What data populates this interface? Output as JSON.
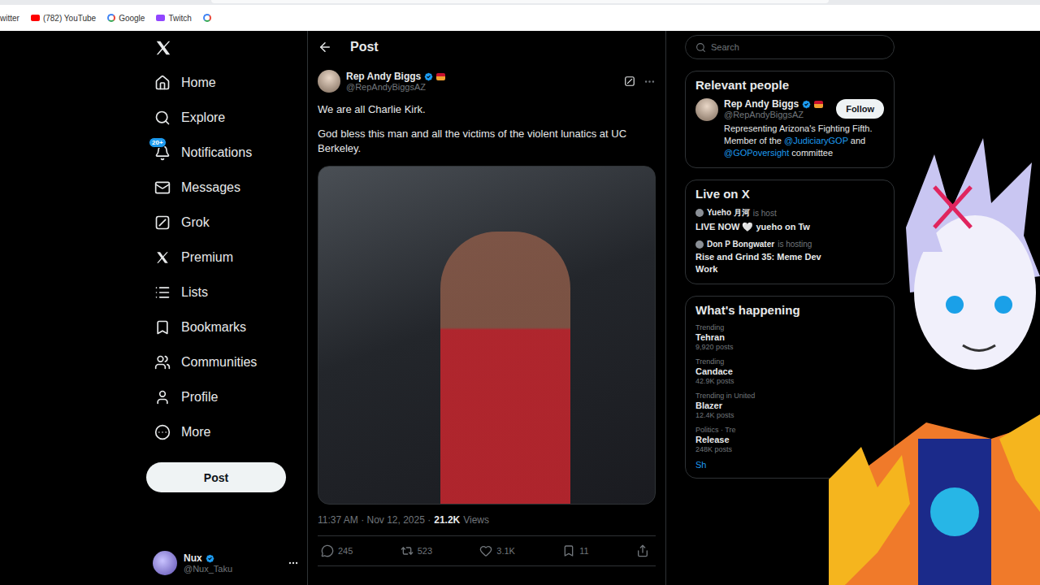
{
  "browser": {
    "bookmarks": [
      {
        "kind": "plain",
        "label": "witter"
      },
      {
        "kind": "youtube",
        "label": "(782) YouTube"
      },
      {
        "kind": "google",
        "label": "Google"
      },
      {
        "kind": "twitch",
        "label": "Twitch"
      },
      {
        "kind": "google",
        "label": ""
      }
    ]
  },
  "nav": {
    "items": [
      {
        "icon": "home",
        "label": "Home",
        "selected": false
      },
      {
        "icon": "explore",
        "label": "Explore",
        "selected": false
      },
      {
        "icon": "notifications",
        "label": "Notifications",
        "selected": false,
        "badge": "20+"
      },
      {
        "icon": "messages",
        "label": "Messages",
        "selected": false
      },
      {
        "icon": "grok",
        "label": "Grok",
        "selected": false
      },
      {
        "icon": "premium",
        "label": "Premium",
        "selected": false
      },
      {
        "icon": "lists",
        "label": "Lists",
        "selected": false
      },
      {
        "icon": "bookmarks",
        "label": "Bookmarks",
        "selected": false
      },
      {
        "icon": "communities",
        "label": "Communities",
        "selected": false
      },
      {
        "icon": "profile",
        "label": "Profile",
        "selected": false
      },
      {
        "icon": "more",
        "label": "More",
        "selected": false
      }
    ],
    "post_button": "Post",
    "account": {
      "name": "Nux",
      "handle": "@Nux_Taku",
      "verified": true
    }
  },
  "header": {
    "title": "Post"
  },
  "post": {
    "author": {
      "name": "Rep Andy Biggs",
      "handle": "@RepAndyBiggsAZ",
      "verified": true
    },
    "paragraphs": [
      "We are all Charlie Kirk.",
      "God bless this man and all the victims of the violent lunatics at UC Berkeley."
    ],
    "timestamp": "11:37 AM · Nov 12, 2025 ·",
    "views": "21.2K",
    "views_label": "Views",
    "actions": [
      {
        "kind": "reply",
        "count": "245"
      },
      {
        "kind": "repost",
        "count": "523"
      },
      {
        "kind": "like",
        "count": "3.1K"
      },
      {
        "kind": "bookmark",
        "count": "11"
      },
      {
        "kind": "share",
        "count": ""
      }
    ]
  },
  "search": {
    "placeholder": "Search"
  },
  "relevant_people": {
    "title": "Relevant people",
    "person": {
      "name": "Rep Andy Biggs",
      "handle": "@RepAndyBiggsAZ",
      "verified": true,
      "button": "Follow",
      "bio": [
        {
          "text": "Representing Arizona's Fighting Fifth. Member of the ",
          "link": false
        },
        {
          "text": "@JudiciaryGOP",
          "link": true
        },
        {
          "text": " and ",
          "link": false
        },
        {
          "text": "@GOPoversight",
          "link": true
        },
        {
          "text": " committee",
          "link": false
        }
      ]
    }
  },
  "live": {
    "title": "Live on X",
    "items": [
      {
        "host": "Yueho 月河",
        "status": "is host",
        "title": "LIVE NOW 🤍 yueho on Tw"
      },
      {
        "host": "Don P Bongwater",
        "status": "is hosting",
        "title": "Rise and Grind 35: Meme Dev Work"
      }
    ]
  },
  "trending": {
    "title": "What's happening",
    "items": [
      {
        "context": "Trending",
        "topic": "Tehran",
        "posts": "9,920 posts"
      },
      {
        "context": "Trending",
        "topic": "Candace",
        "posts": "42.9K posts"
      },
      {
        "context": "Trending in United",
        "topic": "Blazer",
        "posts": "12.4K posts"
      },
      {
        "context": "Politics · Tre",
        "topic": "Release",
        "posts": "248K posts"
      }
    ],
    "more": "Sh"
  }
}
